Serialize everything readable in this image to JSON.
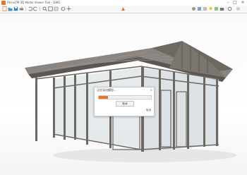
{
  "window": {
    "title": "RhinoTM 3D Model Viewer Tool - DWG"
  },
  "toolbar": {
    "buttons": [
      "new-icon",
      "open-icon",
      "save-icon",
      "print-icon",
      "undo-icon",
      "redo-icon",
      "cut-icon",
      "copy-icon",
      "paste-icon",
      "select-icon",
      "pan-icon",
      "rotate-icon",
      "zoom-icon",
      "zoom-window-icon",
      "zoom-extents-icon"
    ],
    "right_buttons": [
      "render-icon",
      "layer-icon",
      "properties-icon",
      "light-icon",
      "material-icon",
      "camera-icon",
      "settings-icon"
    ]
  },
  "colors": {
    "accent": "#e8742a",
    "frame": "#6e6862",
    "glass": "#cfd8dc",
    "roof": "#8a8580"
  },
  "dialog": {
    "title": "正在导出模型...",
    "close": "×",
    "progress": 0.18,
    "cancel_label": "取消",
    "status": "取消"
  }
}
